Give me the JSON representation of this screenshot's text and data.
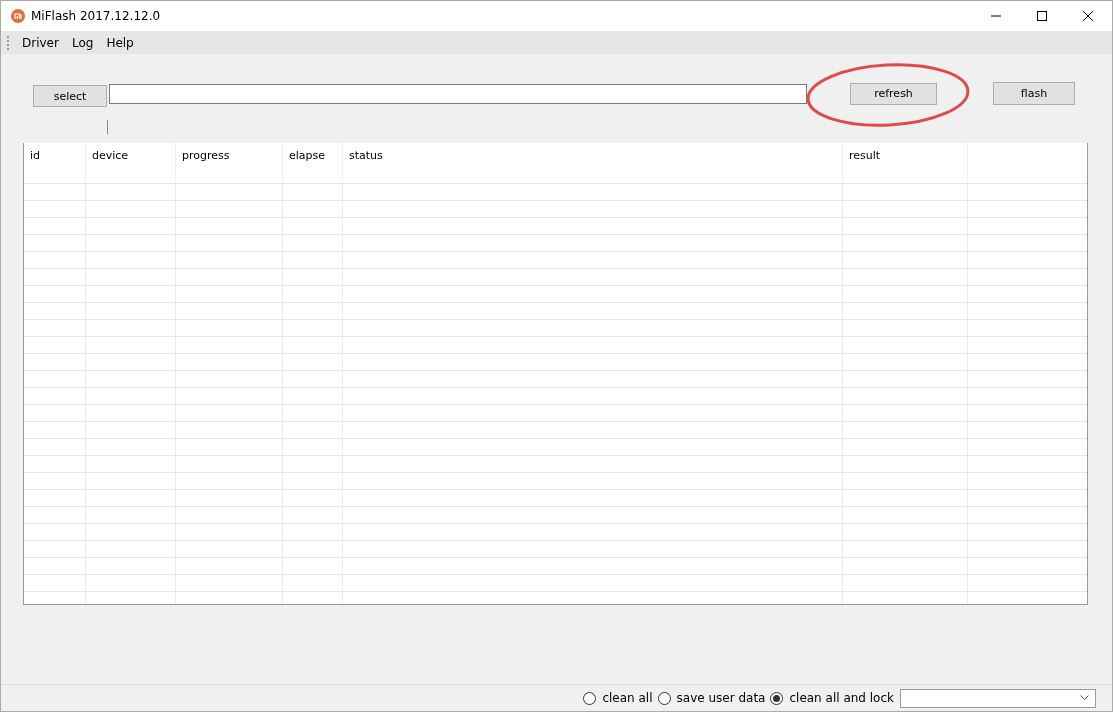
{
  "window": {
    "title": "MiFlash 2017.12.12.0"
  },
  "menu": [
    {
      "label": "Driver"
    },
    {
      "label": "Log"
    },
    {
      "label": "Help"
    }
  ],
  "toolbar": {
    "select_button": "select",
    "refresh_button": "refresh",
    "flash_button": "flash"
  },
  "table": {
    "columns": [
      "id",
      "device",
      "progress",
      "elapse",
      "status",
      "result"
    ]
  },
  "flash_options": [
    {
      "label": "clean all",
      "selected": false
    },
    {
      "label": "save user data",
      "selected": false
    },
    {
      "label": "clean all and lock",
      "selected": true
    }
  ]
}
